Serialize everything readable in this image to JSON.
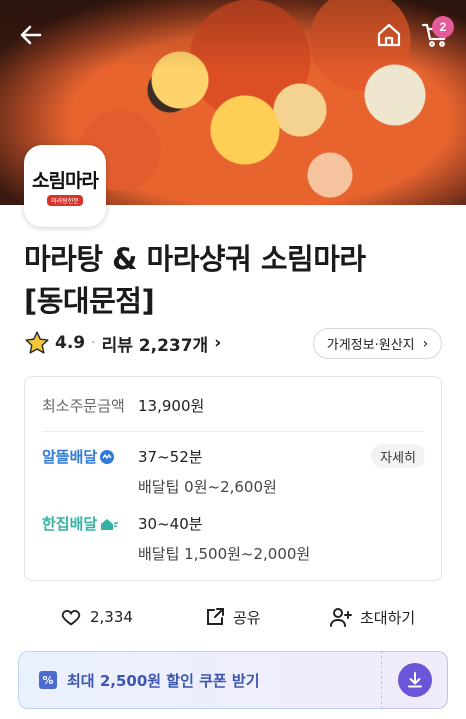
{
  "header": {
    "back_icon": "arrow-left-icon",
    "home_icon": "home-icon",
    "cart_icon": "cart-icon",
    "cart_count": "2"
  },
  "store": {
    "logo_text": "소림마라",
    "logo_sub": "마라탕전문",
    "title_line1": "마라탕 & 마라샹궈 소림마라",
    "title_line2": "[동대문점]",
    "rating": "4.9",
    "review_text": "리뷰 2,237개",
    "info_button": "가게정보·원산지"
  },
  "delivery": {
    "min_order_label": "최소주문금액",
    "min_order_value": "13,900원",
    "options": [
      {
        "name": "알뜰배달",
        "time": "37~52분",
        "tip": "배달팁 0원~2,600원"
      },
      {
        "name": "한집배달",
        "time": "30~40분",
        "tip": "배달팁 1,500원~2,000원"
      }
    ],
    "detail_button": "자세히"
  },
  "actions": {
    "like_count": "2,334",
    "share_label": "공유",
    "invite_label": "초대하기"
  },
  "coupon": {
    "label": "최대 2,500원 할인 쿠폰 받기",
    "tag_glyph": "%"
  },
  "colors": {
    "accent_blue": "#2f7ad9",
    "accent_teal": "#35b2a4",
    "coupon_purple": "#6b55d9",
    "badge_pink": "#e45a9a"
  }
}
